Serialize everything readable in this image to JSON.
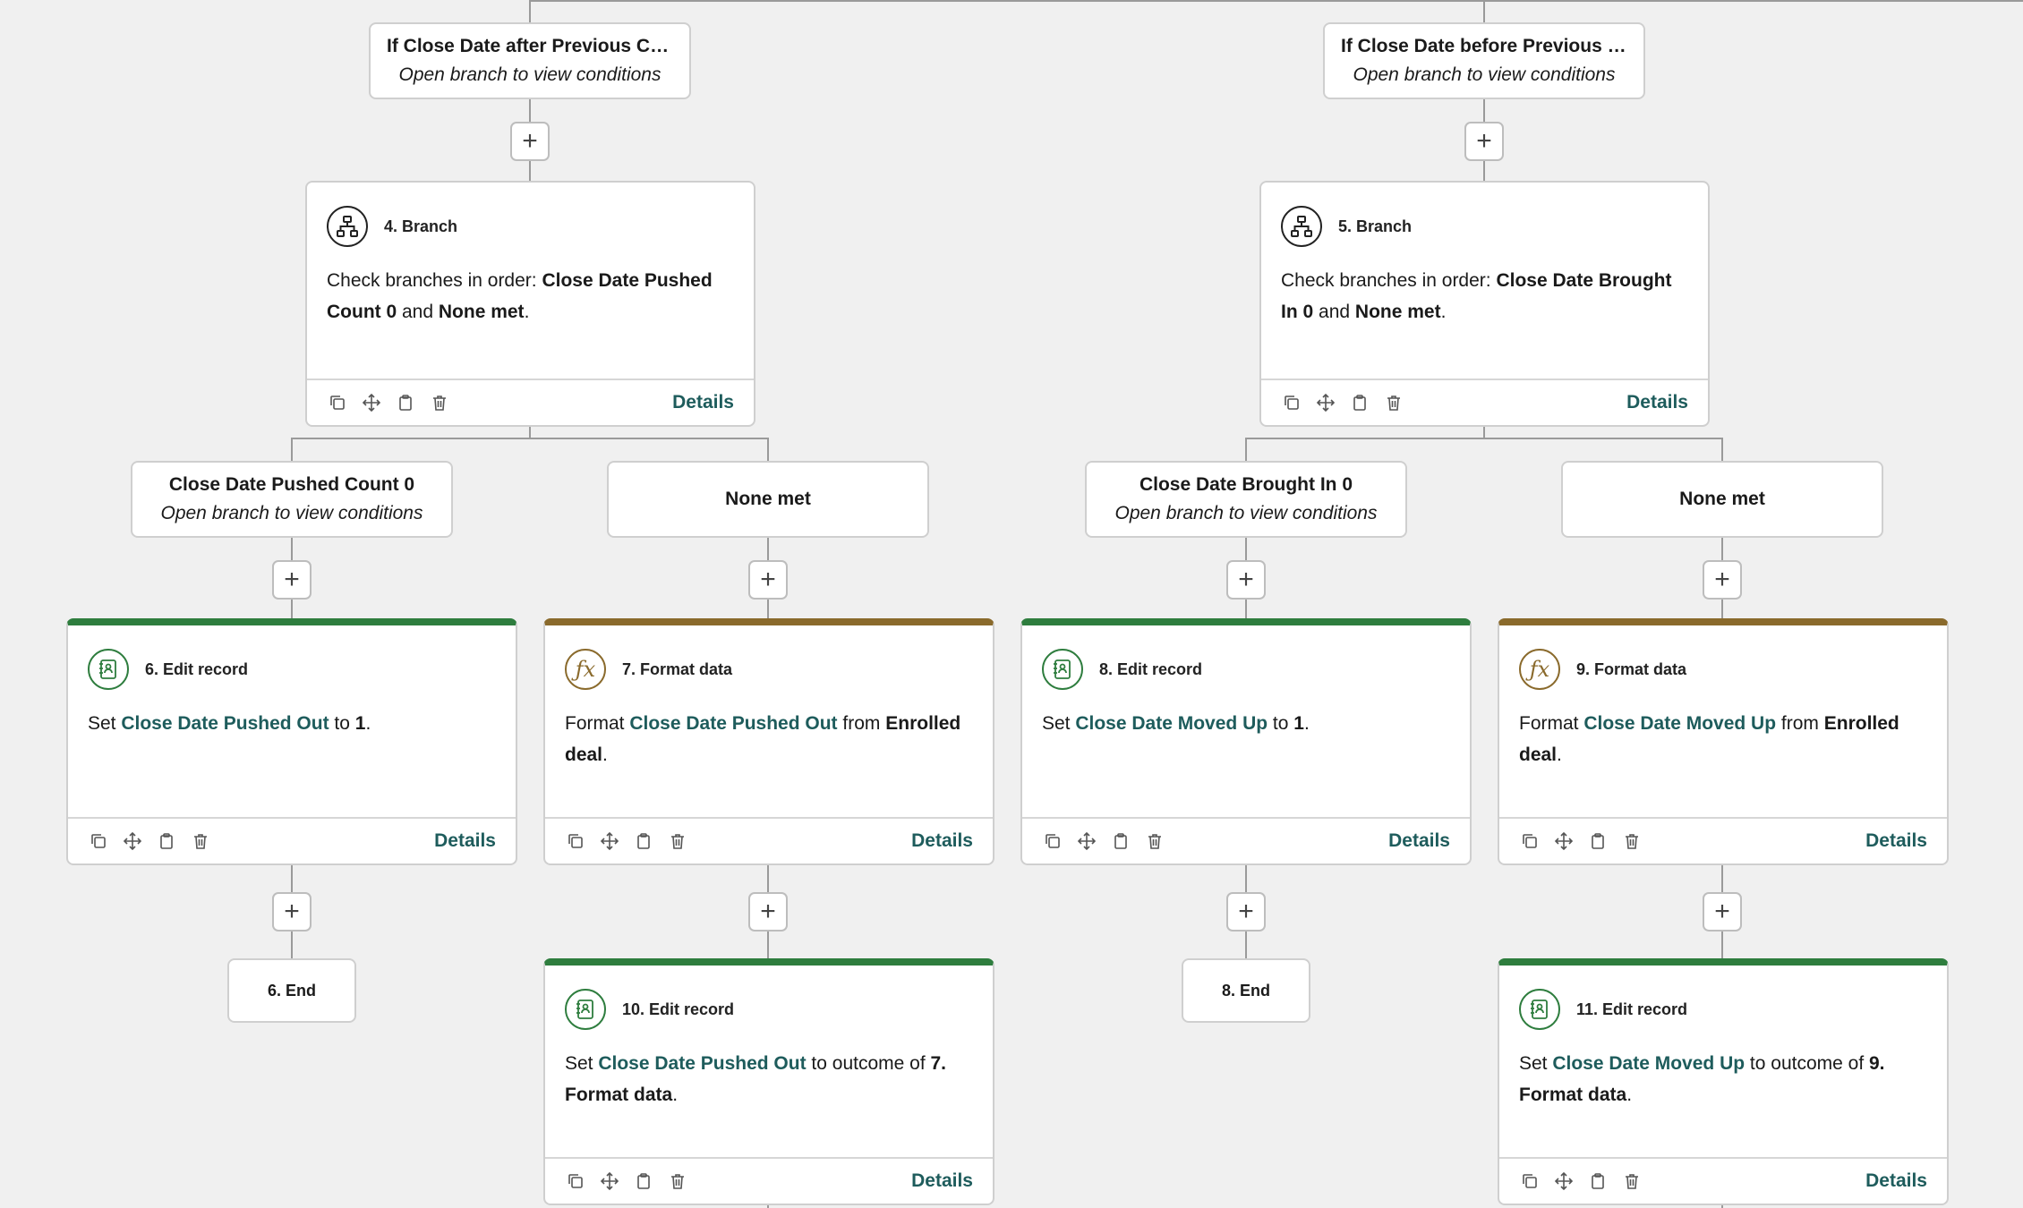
{
  "colors": {
    "green": "#2e7d3e",
    "brown": "#8a6a2c",
    "link": "#1e5c5c"
  },
  "top_branches": [
    {
      "title": "If Close Date after Previous Clo...",
      "sub": "Open branch to view conditions"
    },
    {
      "title": "If Close Date before Previous C...",
      "sub": "Open branch to view conditions"
    }
  ],
  "branch_cards": [
    {
      "label": "4. Branch",
      "prefix": "Check branches in order: ",
      "b1": "Close Date Pushed Count 0",
      "mid": " and ",
      "b2": "None met",
      "end": ".",
      "details": "Details",
      "icon": "branch-icon"
    },
    {
      "label": "5. Branch",
      "prefix": "Check branches in order: ",
      "b1": "Close Date Brought In 0",
      "mid": " and ",
      "b2": "None met",
      "end": ".",
      "details": "Details",
      "icon": "branch-icon"
    }
  ],
  "sub_branches": [
    {
      "title": "Close Date Pushed Count 0",
      "sub": "Open branch to view conditions"
    },
    {
      "title": "None met",
      "sub": ""
    },
    {
      "title": "Close Date Brought In 0",
      "sub": "Open branch to view conditions"
    },
    {
      "title": "None met",
      "sub": ""
    }
  ],
  "action_cards": [
    {
      "label": "6. Edit record",
      "verb": "Set ",
      "field": "Close Date Pushed Out",
      "mid": " to ",
      "value": "1",
      "tail": ".",
      "details": "Details",
      "icon": "edit-record-icon"
    },
    {
      "label": "7. Format data",
      "verb": "Format ",
      "field": "Close Date Pushed Out",
      "mid": " from ",
      "value": "Enrolled deal",
      "tail": ".",
      "details": "Details",
      "icon": "function-icon"
    },
    {
      "label": "8. Edit record",
      "verb": "Set ",
      "field": "Close Date Moved Up",
      "mid": " to ",
      "value": "1",
      "tail": ".",
      "details": "Details",
      "icon": "edit-record-icon"
    },
    {
      "label": "9. Format data",
      "verb": "Format ",
      "field": "Close Date Moved Up",
      "mid": " from ",
      "value": "Enrolled deal",
      "tail": ".",
      "details": "Details",
      "icon": "function-icon"
    }
  ],
  "ends": [
    "6. End",
    "8. End"
  ],
  "edit_cards": [
    {
      "label": "10. Edit record",
      "verb": "Set ",
      "field": "Close Date Pushed Out",
      "mid": " to outcome of ",
      "value": "7. Format data",
      "tail": ".",
      "details": "Details",
      "icon": "edit-record-icon"
    },
    {
      "label": "11. Edit record",
      "verb": "Set ",
      "field": "Close Date Moved Up",
      "mid": " to outcome of ",
      "value": "9. Format data",
      "tail": ".",
      "details": "Details",
      "icon": "edit-record-icon"
    }
  ],
  "plus_label": "+"
}
